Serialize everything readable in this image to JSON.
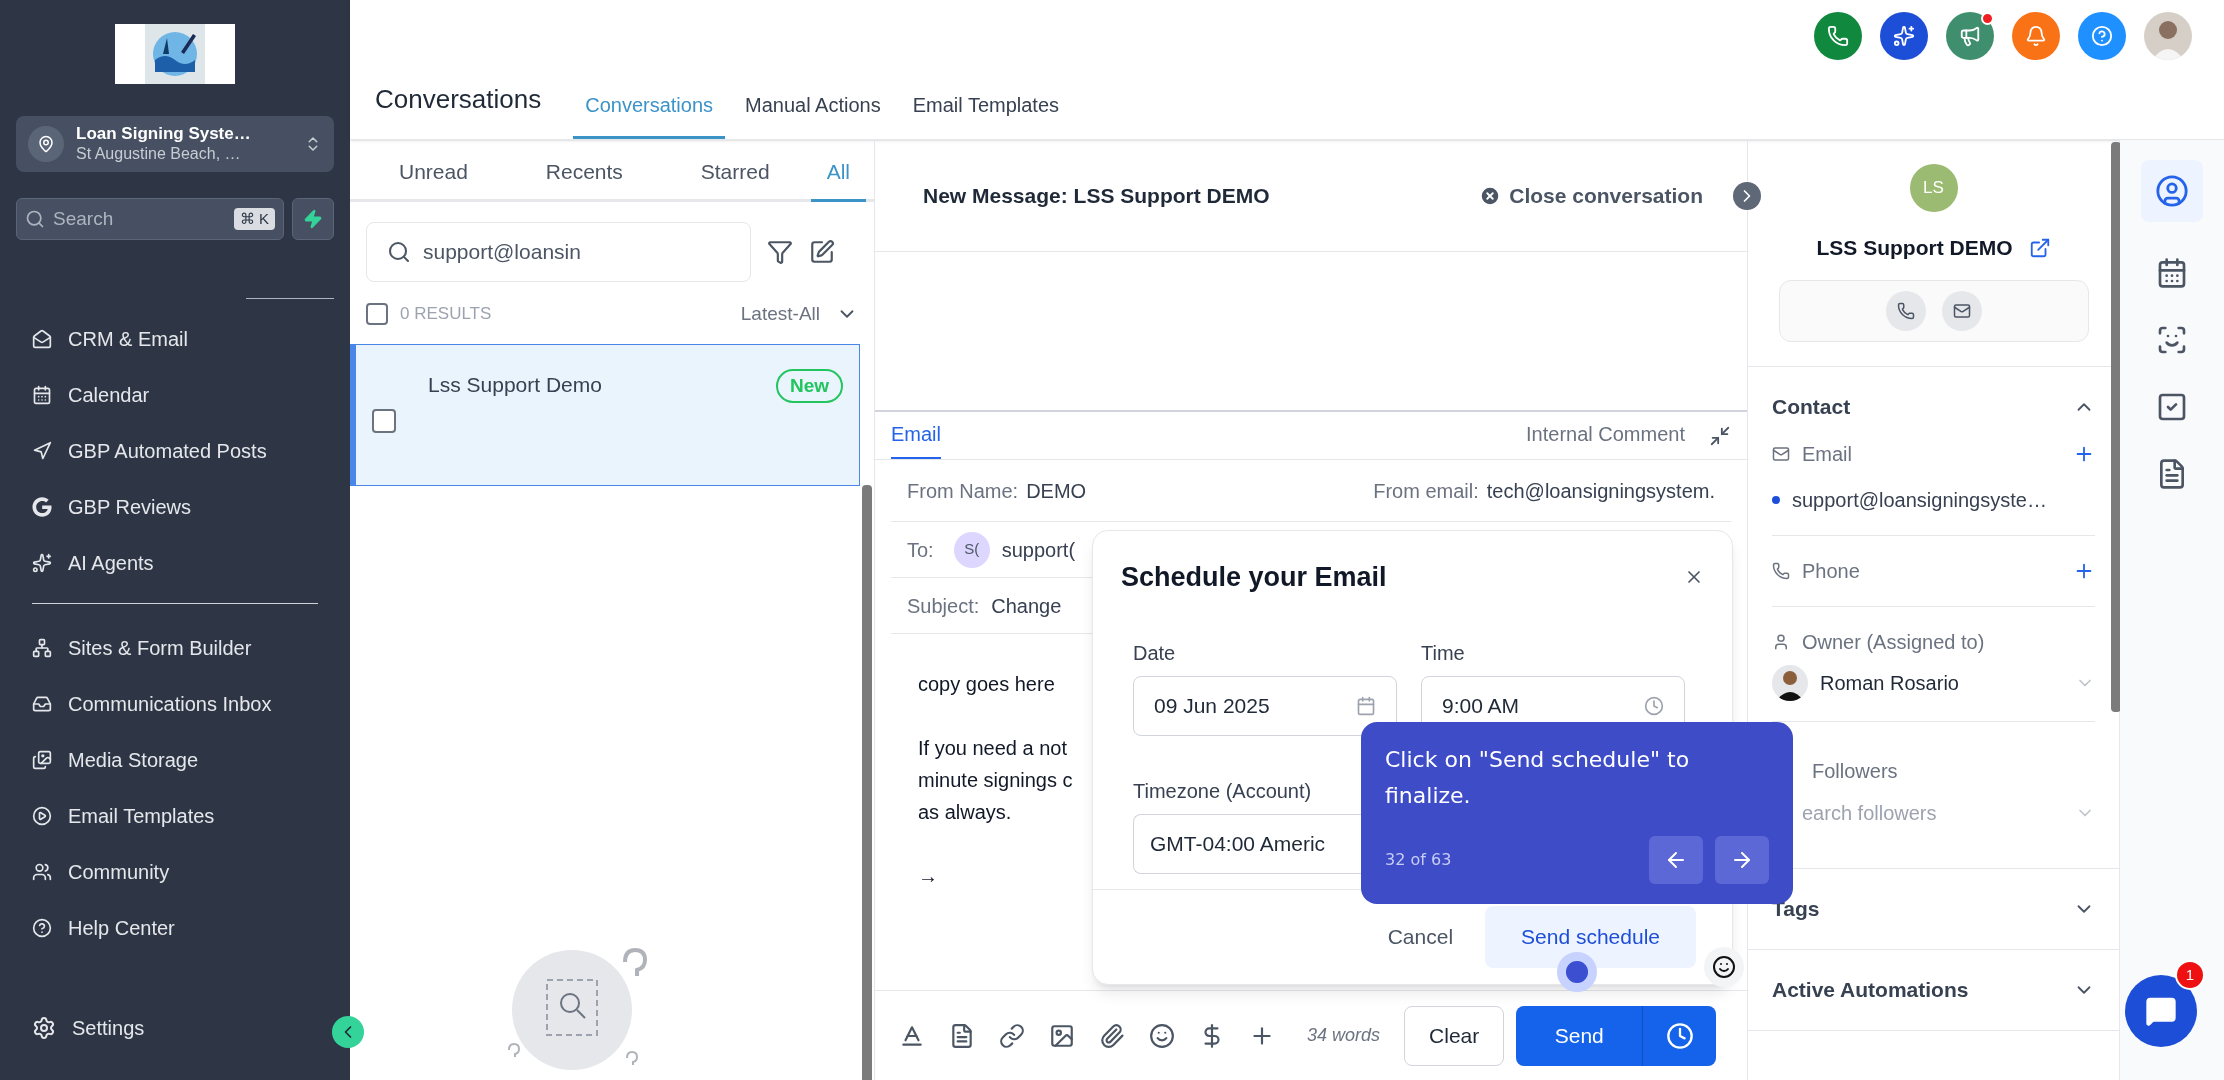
{
  "sidebar": {
    "account": {
      "name": "Loan Signing Syste…",
      "location": "St Augustine Beach, …"
    },
    "search": {
      "placeholder": "Search",
      "shortcut": "⌘ K"
    },
    "groups": [
      [
        {
          "label": "CRM & Email"
        },
        {
          "label": "Calendar"
        },
        {
          "label": "GBP Automated Posts"
        },
        {
          "label": "GBP Reviews"
        },
        {
          "label": "AI Agents"
        }
      ],
      [
        {
          "label": "Sites & Form Builder"
        },
        {
          "label": "Communications Inbox"
        },
        {
          "label": "Media Storage"
        },
        {
          "label": "Email Templates"
        },
        {
          "label": "Community"
        },
        {
          "label": "Help Center"
        }
      ]
    ],
    "settings": "Settings"
  },
  "header": {
    "title": "Conversations",
    "tabs": [
      {
        "label": "Conversations",
        "selected": true
      },
      {
        "label": "Manual Actions",
        "selected": false
      },
      {
        "label": "Email Templates",
        "selected": false
      }
    ]
  },
  "conversation_list": {
    "tabs": [
      {
        "label": "Unread",
        "selected": false
      },
      {
        "label": "Recents",
        "selected": false
      },
      {
        "label": "Starred",
        "selected": false
      },
      {
        "label": "All",
        "selected": true
      }
    ],
    "search": {
      "value": "support@loansin"
    },
    "all_checked": false,
    "results": "0 RESULTS",
    "sort": "Latest-All",
    "rows": [
      {
        "name": "Lss Support Demo",
        "badge": "New",
        "selected": true,
        "checked": false
      }
    ]
  },
  "message": {
    "title": "New Message: LSS Support DEMO",
    "close": "Close conversation",
    "compose_tabs": [
      {
        "label": "Email",
        "selected": true
      },
      {
        "label": "Internal Comment",
        "selected": false
      }
    ],
    "from_name": {
      "label": "From Name:",
      "value": "DEMO"
    },
    "from_email": {
      "label": "From email:",
      "value": "tech@loansigningsystem."
    },
    "to": {
      "label": "To:",
      "initials": "S(",
      "value": "support("
    },
    "subject": {
      "label": "Subject:",
      "value": "Change"
    },
    "body": [
      [
        "copy goes here"
      ],
      [
        "If you need a not",
        "minute signings c",
        "as always."
      ]
    ],
    "arrow": "→",
    "word_count": "34 words",
    "clear": "Clear",
    "send": "Send"
  },
  "schedule_dialog": {
    "title": "Schedule your Email",
    "date": {
      "label": "Date",
      "value": "09 Jun 2025"
    },
    "time": {
      "label": "Time",
      "value": "9:00 AM"
    },
    "timezone": {
      "label": "Timezone (Account)",
      "value": "GMT-04:00 Americ"
    },
    "cancel": "Cancel",
    "confirm": "Send schedule"
  },
  "tour_tip": {
    "text": "Click on \"Send schedule\" to finalize.",
    "step": "32 of 63"
  },
  "contact": {
    "initials": "LS",
    "name": "LSS Support DEMO",
    "sections": [
      {
        "title": "Contact",
        "expanded": true
      },
      {
        "title": "Tags",
        "expanded": false
      },
      {
        "title": "Active Automations",
        "expanded": false
      }
    ],
    "email_label": "Email",
    "email": "support@loansigningsyste…",
    "phone_label": "Phone",
    "owner_label": "Owner (Assigned to)",
    "owner": "Roman Rosario",
    "followers_label": "Followers",
    "followers_placeholder": "earch followers"
  },
  "chat_badge": "1"
}
